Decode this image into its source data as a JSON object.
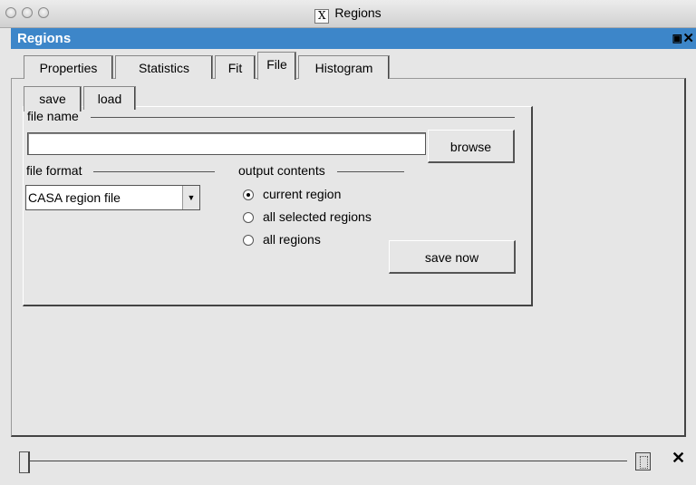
{
  "window": {
    "title": "Regions"
  },
  "dock": {
    "title": "Regions",
    "float_icon": "float-icon",
    "close_icon": "close-icon"
  },
  "main_tabs": [
    {
      "label": "Properties",
      "active": false
    },
    {
      "label": "Statistics",
      "active": false
    },
    {
      "label": "Fit",
      "active": false
    },
    {
      "label": "File",
      "active": true
    },
    {
      "label": "Histogram",
      "active": false
    }
  ],
  "file_tabs": [
    {
      "label": "save",
      "active": true
    },
    {
      "label": "load",
      "active": false
    }
  ],
  "save": {
    "file_name_label": "file name",
    "file_name_value": "",
    "browse_label": "browse",
    "file_format_label": "file format",
    "file_format_value": "CASA region file",
    "output_contents_label": "output contents",
    "options": [
      {
        "label": "current region",
        "selected": true
      },
      {
        "label": "all selected regions",
        "selected": false
      },
      {
        "label": "all regions",
        "selected": false
      }
    ],
    "save_now_label": "save now"
  },
  "footer": {
    "slider_value": 0,
    "trash_icon": "trash-icon",
    "close_icon": "close-icon"
  }
}
